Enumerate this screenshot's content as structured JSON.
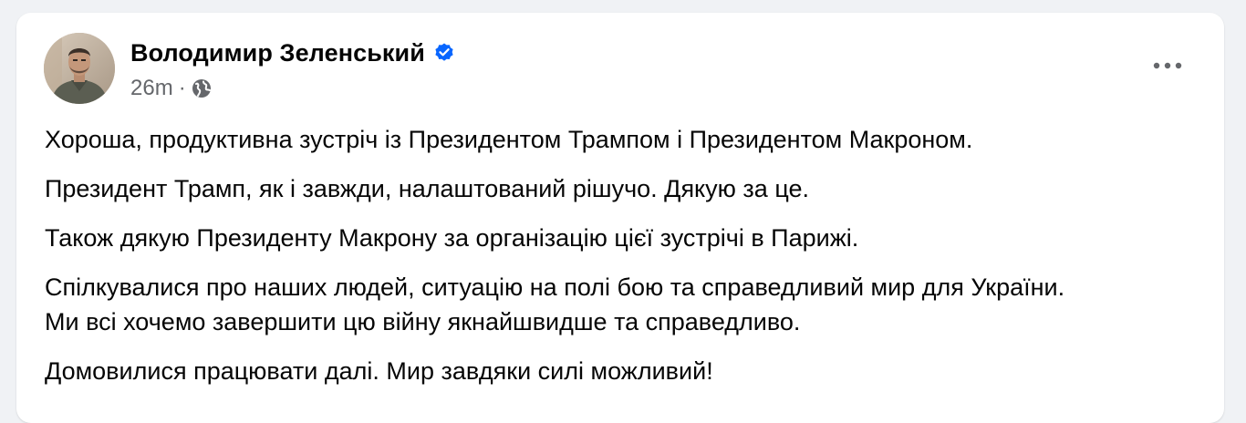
{
  "post": {
    "author": "Володимир Зеленський",
    "verified": true,
    "time": "26m",
    "separator": "·",
    "audience_icon": "globe-icon",
    "more_icon": "more-options-icon",
    "paragraphs": [
      "Хороша, продуктивна зустріч із Президентом Трампом і Президентом Макроном.",
      "Президент Трамп, як і завжди, налаштований рішучо. Дякую за це.",
      "Також дякую Президенту Макрону за організацію цієї зустрічі в Парижі.",
      "Спілкувалися про наших людей, ситуацію на полі бою та справедливий мир для України.",
      "Ми всі хочемо завершити цю війну якнайшвидше та справедливо.",
      "Домовилися працювати далі. Мир завдяки силі можливий!"
    ]
  },
  "colors": {
    "background": "#f0f2f5",
    "card": "#ffffff",
    "text": "#050505",
    "secondary_text": "#65676b",
    "verified_badge": "#0866ff"
  }
}
